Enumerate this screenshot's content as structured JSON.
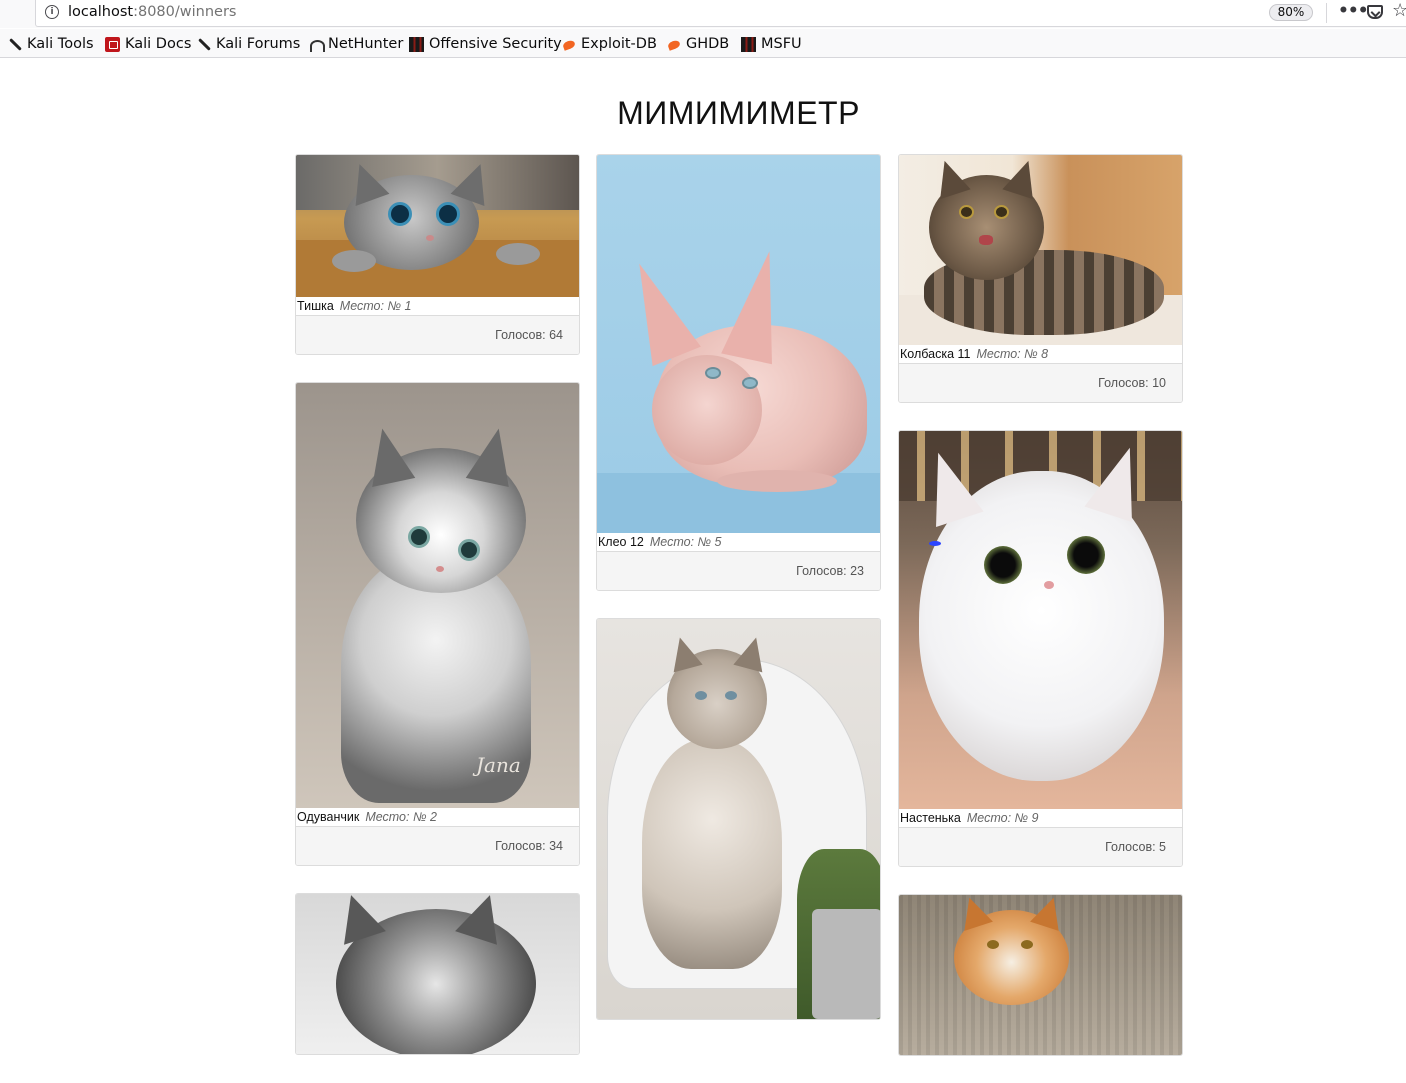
{
  "browser": {
    "url_host": "localhost",
    "url_path": ":8080/winners",
    "zoom": "80%",
    "bookmarks": [
      {
        "label": "Kali Tools",
        "icon": "kali-dragon-icon"
      },
      {
        "label": "Kali Docs",
        "icon": "kali-docs-icon"
      },
      {
        "label": "Kali Forums",
        "icon": "kali-dragon-icon"
      },
      {
        "label": "NetHunter",
        "icon": "nethunter-icon"
      },
      {
        "label": "Offensive Security",
        "icon": "offsec-icon"
      },
      {
        "label": "Exploit-DB",
        "icon": "exploitdb-icon"
      },
      {
        "label": "GHDB",
        "icon": "exploitdb-icon"
      },
      {
        "label": "MSFU",
        "icon": "offsec-icon"
      }
    ]
  },
  "page": {
    "title": "МИМИМИМЕТР",
    "place_prefix": "Место:",
    "votes_prefix": "Голосов:"
  },
  "cards": [
    {
      "name": "Тишка",
      "place": "Место: № 1",
      "votes": "Голосов: 64",
      "column": 1
    },
    {
      "name": "Одуванчик",
      "place": "Место: № 2",
      "votes": "Голосов: 34",
      "column": 1
    },
    {
      "name": "Клео 12",
      "place": "Место: № 5",
      "votes": "Голосов: 23",
      "column": 2
    },
    {
      "name": "Колбаска 11",
      "place": "Место: № 8",
      "votes": "Голосов: 10",
      "column": 3
    },
    {
      "name": "Настенька",
      "place": "Место: № 9",
      "votes": "Голосов: 5",
      "column": 3
    }
  ],
  "colors": {
    "accent_bg": "#f5f5f5",
    "border": "#dcdcdc",
    "text": "#111111",
    "muted": "#666666"
  }
}
